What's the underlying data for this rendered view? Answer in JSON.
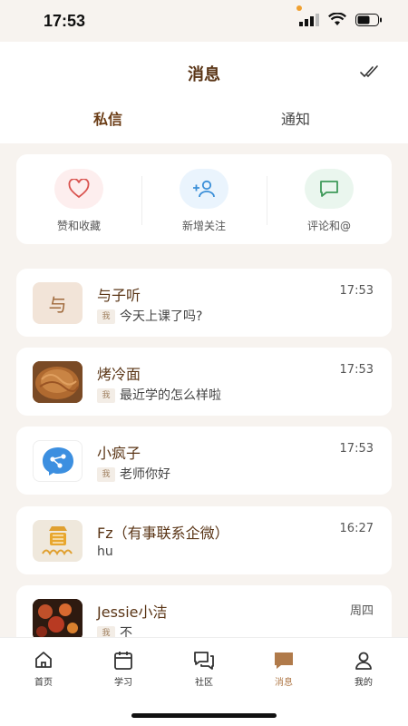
{
  "status": {
    "time": "17:53"
  },
  "header": {
    "title": "消息",
    "mark_read_icon": "double-check-icon"
  },
  "tabs": [
    {
      "label": "私信",
      "active": true
    },
    {
      "label": "通知",
      "active": false
    }
  ],
  "quick_actions": [
    {
      "label": "赞和收藏",
      "icon": "heart-icon",
      "color": "#d9534f",
      "bg": "#fdeeee"
    },
    {
      "label": "新增关注",
      "icon": "add-user-icon",
      "color": "#3b8fd8",
      "bg": "#eaf4fd"
    },
    {
      "label": "评论和@",
      "icon": "comment-icon",
      "color": "#3f9a5a",
      "bg": "#eaf6ee"
    }
  ],
  "me_label": "我",
  "conversations": [
    {
      "name": "与子听",
      "time": "17:53",
      "message": "今天上课了吗?",
      "from_me": true,
      "avatar_text": "与"
    },
    {
      "name": "烤冷面",
      "time": "17:53",
      "message": "最近学的怎么样啦",
      "from_me": true
    },
    {
      "name": "小疯子",
      "time": "17:53",
      "message": "老师你好",
      "from_me": true
    },
    {
      "name": "Fz（有事联系企微）",
      "time": "16:27",
      "message": "hu",
      "from_me": false
    },
    {
      "name": "Jessie小洁",
      "time": "周四",
      "message": "不",
      "from_me": true
    }
  ],
  "tabbar": [
    {
      "label": "首页",
      "icon": "home-icon",
      "active": false
    },
    {
      "label": "学习",
      "icon": "calendar-icon",
      "active": false
    },
    {
      "label": "社区",
      "icon": "chat-bubbles-icon",
      "active": false
    },
    {
      "label": "消息",
      "icon": "message-icon",
      "active": true
    },
    {
      "label": "我的",
      "icon": "profile-icon",
      "active": false
    }
  ],
  "colors": {
    "accent": "#6b3d16",
    "active_tab": "#b07a4a",
    "background": "#f7f3ef"
  }
}
